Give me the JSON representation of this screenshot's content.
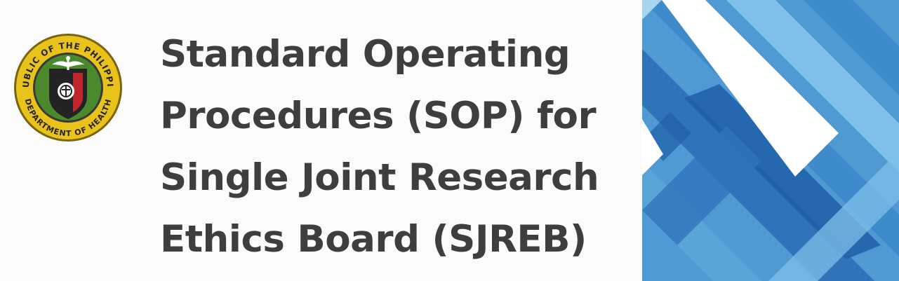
{
  "seal": {
    "top_text": "REPUBLIC OF THE PHILIPPINES",
    "bottom_text": "DEPARTMENT OF HEALTH",
    "colors": {
      "ring": "#e9c31c",
      "ring_edge": "#7a6410",
      "field": "#4a8a2c",
      "shield_dark": "#232323",
      "shield_red": "#c0262b",
      "white": "#ffffff"
    }
  },
  "title": {
    "lines": [
      "Standard Operating",
      "Procedures (SOP) for",
      "Single Joint Research",
      "Ethics Board (SJREB)"
    ],
    "color": "#3e3e40"
  },
  "pattern": {
    "colors": [
      "#5aa5d8",
      "#2f74bb",
      "#3d8bcb",
      "#7ec0e8",
      "#1f5fa8",
      "#ffffff"
    ]
  }
}
